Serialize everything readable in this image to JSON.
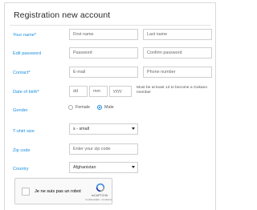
{
  "form": {
    "title": "Registration new account",
    "labels": {
      "your_name": "Your name*",
      "edit_password": "Edit password",
      "contact": "Contact*",
      "date_of_birth": "Date of birth*",
      "gender": "Gender",
      "tshirt_size": "T-shirt size",
      "zip_code": "Zip code",
      "country": "Country"
    },
    "placeholders": {
      "first_name": "First name",
      "last_name": "Last name",
      "password": "Password",
      "confirm_password": "Confirm password",
      "email": "E-mail",
      "phone": "Phone number",
      "dd": "dd",
      "mm": "mm",
      "yyyy": "yyyy",
      "zip": "Enter your zip code"
    },
    "age_note": "Must be at least 13 to become a Gokano member",
    "gender_options": {
      "female": "Female",
      "male": "Male",
      "selected": "male"
    },
    "tshirt_selected": "s - small",
    "country_selected": "Afghanistan"
  },
  "captcha": {
    "label": "Je ne suis pas un robot",
    "brand": "reCAPTCHA",
    "links": "Confidentialité - Conditions",
    "checked": false
  },
  "colors": {
    "label": "#1a8fe0",
    "border": "#cfcfcf",
    "title": "#2b2b2b"
  },
  "icons": {
    "select_arrow": "chevron-down-icon",
    "captcha_logo": "recaptcha-logo-icon"
  }
}
